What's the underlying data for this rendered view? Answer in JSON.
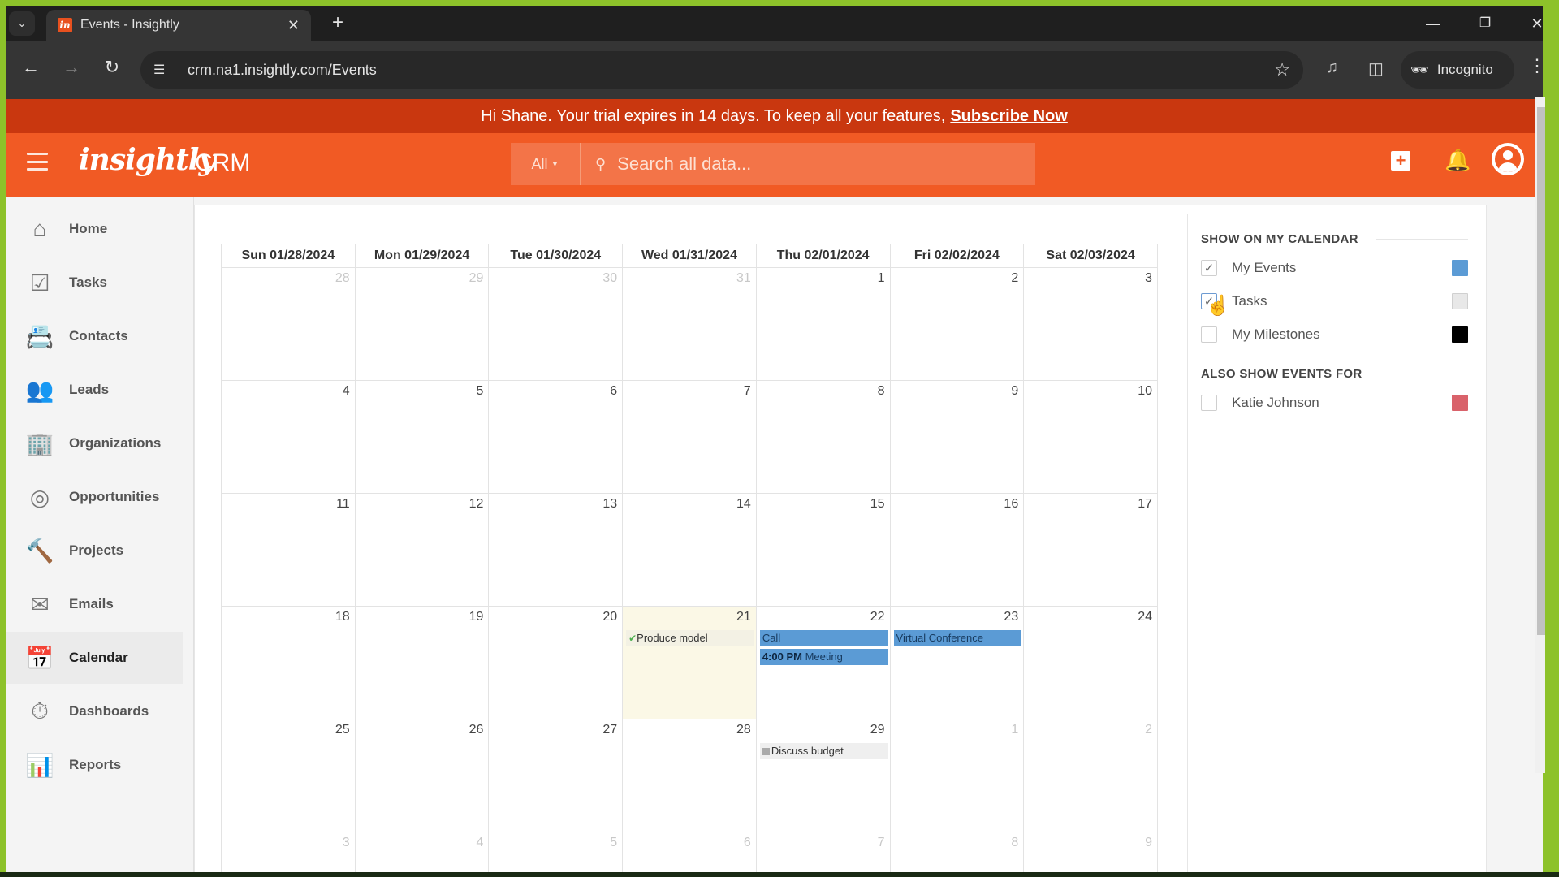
{
  "browser": {
    "tab_title": "Events - Insightly",
    "favicon_text": "in",
    "url": "crm.na1.insightly.com/Events",
    "profile_label": "Incognito",
    "icons": [
      "tab-search-icon",
      "close-icon",
      "new-tab-icon",
      "minimize-icon",
      "restore-icon",
      "window-close-icon",
      "back-icon",
      "forward-icon",
      "reload-icon",
      "site-info-icon",
      "bookmark-star-icon",
      "media-icon",
      "side-panel-icon",
      "incognito-icon",
      "menu-icon"
    ]
  },
  "banner": {
    "text": "Hi Shane. Your trial expires in 14 days. To keep all your features,",
    "link": "Subscribe Now"
  },
  "header": {
    "logo": "insightly",
    "product": "CRM",
    "search_scope": "All",
    "search_placeholder": "Search all data..."
  },
  "sidebar": {
    "items": [
      {
        "label": "Home",
        "icon": "home-icon",
        "active": false
      },
      {
        "label": "Tasks",
        "icon": "tasks-icon",
        "active": false
      },
      {
        "label": "Contacts",
        "icon": "contacts-icon",
        "active": false
      },
      {
        "label": "Leads",
        "icon": "leads-icon",
        "active": false
      },
      {
        "label": "Organizations",
        "icon": "organizations-icon",
        "active": false
      },
      {
        "label": "Opportunities",
        "icon": "opportunities-icon",
        "active": false
      },
      {
        "label": "Projects",
        "icon": "projects-icon",
        "active": false
      },
      {
        "label": "Emails",
        "icon": "emails-icon",
        "active": false
      },
      {
        "label": "Calendar",
        "icon": "calendar-icon",
        "active": true
      },
      {
        "label": "Dashboards",
        "icon": "dashboards-icon",
        "active": false
      },
      {
        "label": "Reports",
        "icon": "reports-icon",
        "active": false
      }
    ]
  },
  "calendar": {
    "headers": [
      "Sun 01/28/2024",
      "Mon 01/29/2024",
      "Tue 01/30/2024",
      "Wed 01/31/2024",
      "Thu 02/01/2024",
      "Fri 02/02/2024",
      "Sat 02/03/2024"
    ],
    "weeks": [
      [
        {
          "d": "28",
          "other": true
        },
        {
          "d": "29",
          "other": true
        },
        {
          "d": "30",
          "other": true
        },
        {
          "d": "31",
          "other": true
        },
        {
          "d": "1"
        },
        {
          "d": "2"
        },
        {
          "d": "3"
        }
      ],
      [
        {
          "d": "4"
        },
        {
          "d": "5"
        },
        {
          "d": "6"
        },
        {
          "d": "7"
        },
        {
          "d": "8"
        },
        {
          "d": "9"
        },
        {
          "d": "10"
        }
      ],
      [
        {
          "d": "11"
        },
        {
          "d": "12"
        },
        {
          "d": "13"
        },
        {
          "d": "14"
        },
        {
          "d": "15"
        },
        {
          "d": "16"
        },
        {
          "d": "17"
        }
      ],
      [
        {
          "d": "18"
        },
        {
          "d": "19"
        },
        {
          "d": "20"
        },
        {
          "d": "21",
          "today": true,
          "events": [
            {
              "type": "task-done",
              "title": "Produce model"
            }
          ]
        },
        {
          "d": "22",
          "events": [
            {
              "type": "event",
              "title": "Call"
            },
            {
              "type": "event",
              "time": "4:00 PM",
              "title": "Meeting"
            }
          ]
        },
        {
          "d": "23",
          "events": [
            {
              "type": "event",
              "title": "Virtual Conference"
            }
          ]
        },
        {
          "d": "24"
        }
      ],
      [
        {
          "d": "25"
        },
        {
          "d": "26"
        },
        {
          "d": "27"
        },
        {
          "d": "28"
        },
        {
          "d": "29",
          "events": [
            {
              "type": "task",
              "title": "Discuss budget"
            }
          ]
        },
        {
          "d": "1",
          "other": true
        },
        {
          "d": "2",
          "other": true
        }
      ],
      [
        {
          "d": "3",
          "other": true
        },
        {
          "d": "4",
          "other": true
        },
        {
          "d": "5",
          "other": true
        },
        {
          "d": "6",
          "other": true
        },
        {
          "d": "7",
          "other": true
        },
        {
          "d": "8",
          "other": true
        },
        {
          "d": "9",
          "other": true
        }
      ]
    ]
  },
  "filters": {
    "show_heading": "SHOW ON MY CALENDAR",
    "show_items": [
      {
        "label": "My Events",
        "checked": true,
        "color": "#5b9bd5"
      },
      {
        "label": "Tasks",
        "checked": true,
        "color": "#e8e8e8"
      },
      {
        "label": "My Milestones",
        "checked": false,
        "color": "#000000"
      }
    ],
    "also_heading": "ALSO SHOW EVENTS FOR",
    "also_items": [
      {
        "label": "Katie Johnson",
        "checked": false,
        "color": "#d9626b"
      }
    ]
  },
  "colors": {
    "brand_orange": "#f15a24",
    "banner_red": "#c9370f",
    "event_blue": "#5b9bd5",
    "today_bg": "#fbf8e6"
  }
}
